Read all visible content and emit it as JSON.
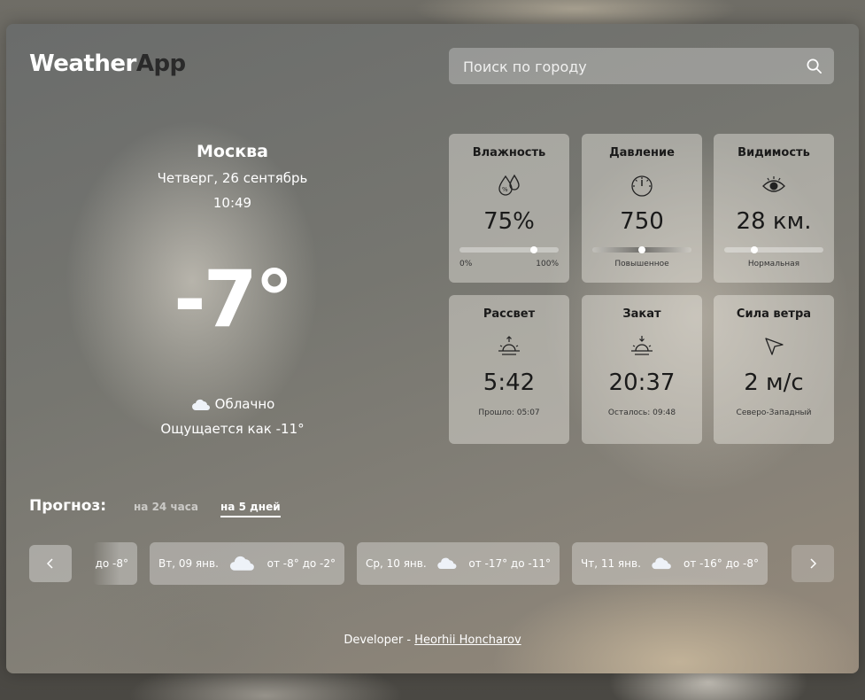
{
  "header": {
    "logo_part1": "Weather",
    "logo_part2": "App",
    "search_placeholder": "Поиск по городу"
  },
  "current": {
    "city": "Москва",
    "date": "Четверг, 26 сентябрь",
    "time": "10:49",
    "temperature": "-7°",
    "condition": "Облачно",
    "feels_like": "Ощущается как -11°"
  },
  "cards": {
    "humidity": {
      "title": "Влажность",
      "value": "75%",
      "min": "0%",
      "max": "100%",
      "level": 0.75
    },
    "pressure": {
      "title": "Давление",
      "value": "750",
      "note": "Повышенное",
      "level": 0.5
    },
    "visibility": {
      "title": "Видимость",
      "value": "28 км.",
      "note": "Нормальная",
      "level": 0.3
    },
    "sunrise": {
      "title": "Рассвет",
      "value": "5:42",
      "note": "Прошло: 05:07"
    },
    "sunset": {
      "title": "Закат",
      "value": "20:37",
      "note": "Осталось: 09:48"
    },
    "wind": {
      "title": "Сила ветра",
      "value": "2 м/с",
      "note": "Северо-Западный"
    }
  },
  "forecast": {
    "title": "Прогноз:",
    "tabs": [
      "на 24 часа",
      "на 5 дней"
    ],
    "active_tab": 1,
    "days": [
      {
        "name": "",
        "range": "до -8°"
      },
      {
        "name": "Вт, 09 янв.",
        "range": "от -8° до -2°"
      },
      {
        "name": "Ср, 10 янв.",
        "range": "от -17° до -11°"
      },
      {
        "name": "Чт, 11 янв.",
        "range": "от -16° до -8°"
      }
    ]
  },
  "footer": {
    "prefix": "Developer - ",
    "author": "Heorhii Honcharov"
  }
}
